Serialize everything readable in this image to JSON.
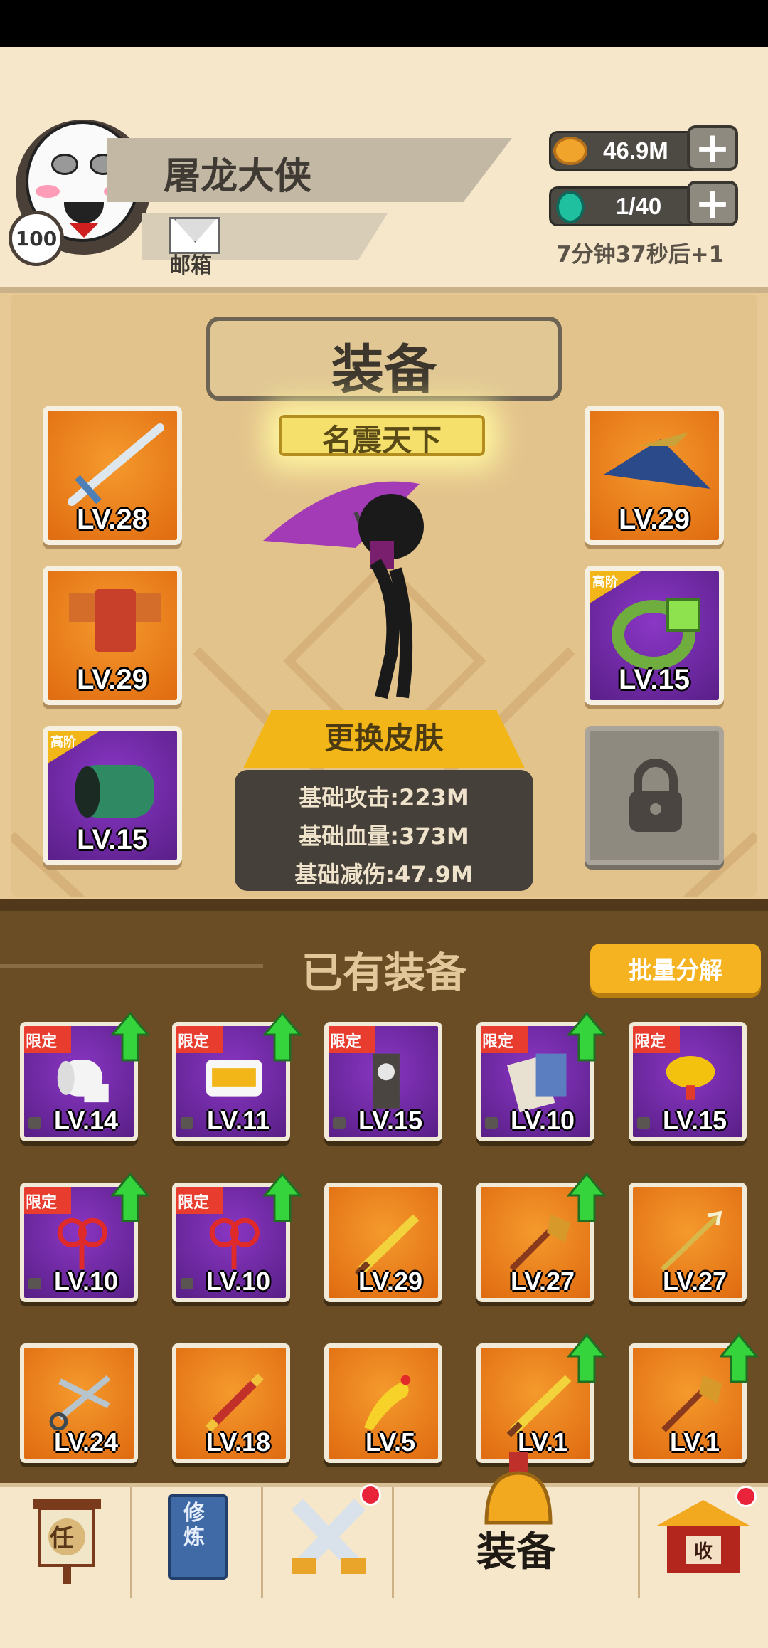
{
  "player": {
    "name": "屠龙大侠",
    "level": "100",
    "mail_label": "邮箱"
  },
  "resources": {
    "coins": "46.9M",
    "stamina": "1/40",
    "stamina_timer": "7分钟37秒后+1"
  },
  "equipment": {
    "title": "装备",
    "rank_title": "名震天下",
    "skin_button": "更换皮肤",
    "stats": [
      "基础攻击:223M",
      "基础血量:373M",
      "基础减伤:47.9M"
    ],
    "slots_left": [
      {
        "level": "LV.28",
        "tier": "orange",
        "item": "sword-icon"
      },
      {
        "level": "LV.29",
        "tier": "orange",
        "item": "armor-icon"
      },
      {
        "level": "LV.15",
        "tier": "purple",
        "item": "bracer-icon",
        "tag": "高阶"
      }
    ],
    "slots_right": [
      {
        "level": "LV.29",
        "tier": "orange",
        "item": "hat-icon"
      },
      {
        "level": "LV.15",
        "tier": "purple",
        "item": "ring-icon",
        "tag": "高阶"
      },
      {
        "locked": true,
        "item": "padlock-icon"
      }
    ]
  },
  "inventory": {
    "title": "已有装备",
    "batch_button": "批量分解",
    "items": [
      {
        "level": "LV.14",
        "tier": "purple",
        "tag": "限定",
        "upgrade": true,
        "item": "toilet-paper-icon",
        "locked": true
      },
      {
        "level": "LV.11",
        "tier": "purple",
        "tag": "限定",
        "upgrade": true,
        "item": "snack-bag-icon",
        "locked": true
      },
      {
        "level": "LV.15",
        "tier": "purple",
        "tag": "限定",
        "upgrade": false,
        "item": "banner-icon",
        "locked": true
      },
      {
        "level": "LV.10",
        "tier": "purple",
        "tag": "限定",
        "upgrade": true,
        "item": "book-icon",
        "locked": true
      },
      {
        "level": "LV.15",
        "tier": "purple",
        "tag": "限定",
        "upgrade": false,
        "item": "gold-ingot-icon",
        "locked": true
      },
      {
        "level": "LV.10",
        "tier": "purple",
        "tag": "限定",
        "upgrade": true,
        "item": "chinese-knot-icon",
        "locked": true
      },
      {
        "level": "LV.10",
        "tier": "purple",
        "tag": "限定",
        "upgrade": true,
        "item": "chinese-knot-icon",
        "locked": true
      },
      {
        "level": "LV.29",
        "tier": "orange",
        "upgrade": false,
        "item": "broadsword-icon"
      },
      {
        "level": "LV.27",
        "tier": "orange",
        "upgrade": true,
        "item": "broom-icon"
      },
      {
        "level": "LV.27",
        "tier": "orange",
        "upgrade": false,
        "item": "trident-icon"
      },
      {
        "level": "LV.24",
        "tier": "orange",
        "upgrade": false,
        "item": "scissors-icon"
      },
      {
        "level": "LV.18",
        "tier": "orange",
        "upgrade": false,
        "item": "staff-icon"
      },
      {
        "level": "LV.5",
        "tier": "orange",
        "upgrade": false,
        "item": "rubber-chicken-icon"
      },
      {
        "level": "LV.1",
        "tier": "orange",
        "upgrade": true,
        "item": "broadsword-icon"
      },
      {
        "level": "LV.1",
        "tier": "orange",
        "upgrade": true,
        "item": "broom-icon"
      }
    ]
  },
  "nav": {
    "tabs": [
      {
        "icon": "task-scroll-icon",
        "glyph": "任"
      },
      {
        "icon": "cultivate-book-icon",
        "glyph": "修炼"
      },
      {
        "icon": "crossed-swords-icon",
        "badge": true
      },
      {
        "icon": "equipment-helmet-icon",
        "label": "装备",
        "active": true
      },
      {
        "icon": "shop-collect-icon",
        "glyph": "收",
        "badge": true
      }
    ]
  },
  "colors": {
    "header_bg": "#f6e7cb",
    "panel_bg": "#e3c38c",
    "inventory_bg": "#6a4d24",
    "orange_tier": "#e8791a",
    "purple_tier": "#6c28a0",
    "accent_yellow": "#f2b619",
    "upgrade_green": "#36d43c",
    "limited_red": "#e73c2e"
  }
}
